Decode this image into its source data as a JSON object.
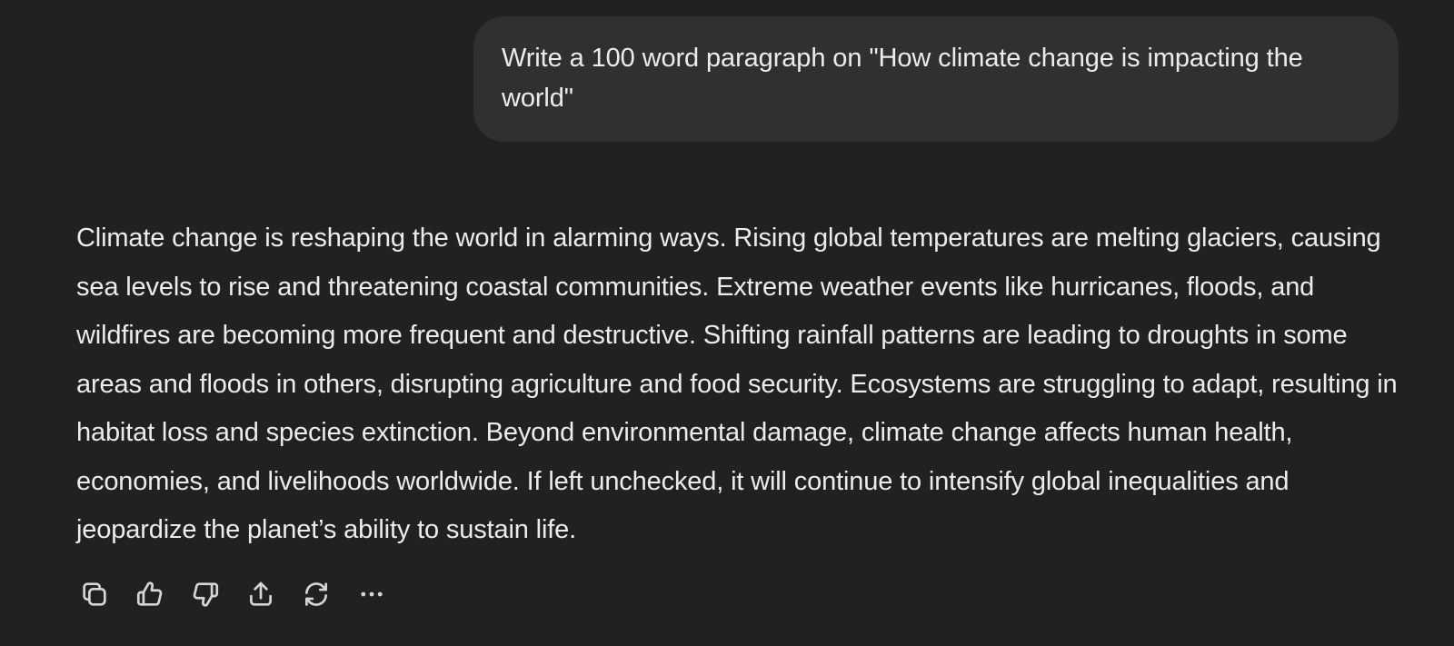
{
  "conversation": {
    "user_message": "Write a 100 word paragraph on \"How climate change is impacting the world\"",
    "assistant_message": "Climate change is reshaping the world in alarming ways. Rising global temperatures are melting glaciers, causing sea levels to rise and threatening coastal communities. Extreme weather events like hurricanes, floods, and wildfires are becoming more frequent and destructive. Shifting rainfall patterns are leading to droughts in some areas and floods in others, disrupting agriculture and food security. Ecosystems are struggling to adapt, resulting in habitat loss and species extinction. Beyond environmental damage, climate change affects human health, economies, and livelihoods worldwide. If left unchecked, it will continue to intensify global inequalities and jeopardize the planet’s ability to sustain life."
  },
  "actions": [
    {
      "icon": "copy-icon"
    },
    {
      "icon": "thumbs-up-icon"
    },
    {
      "icon": "thumbs-down-icon"
    },
    {
      "icon": "share-icon"
    },
    {
      "icon": "regenerate-icon"
    },
    {
      "icon": "more-icon"
    }
  ],
  "colors": {
    "background": "#212121",
    "user_bubble": "#303030",
    "text": "#ececec",
    "icon": "#d6d6d6"
  }
}
